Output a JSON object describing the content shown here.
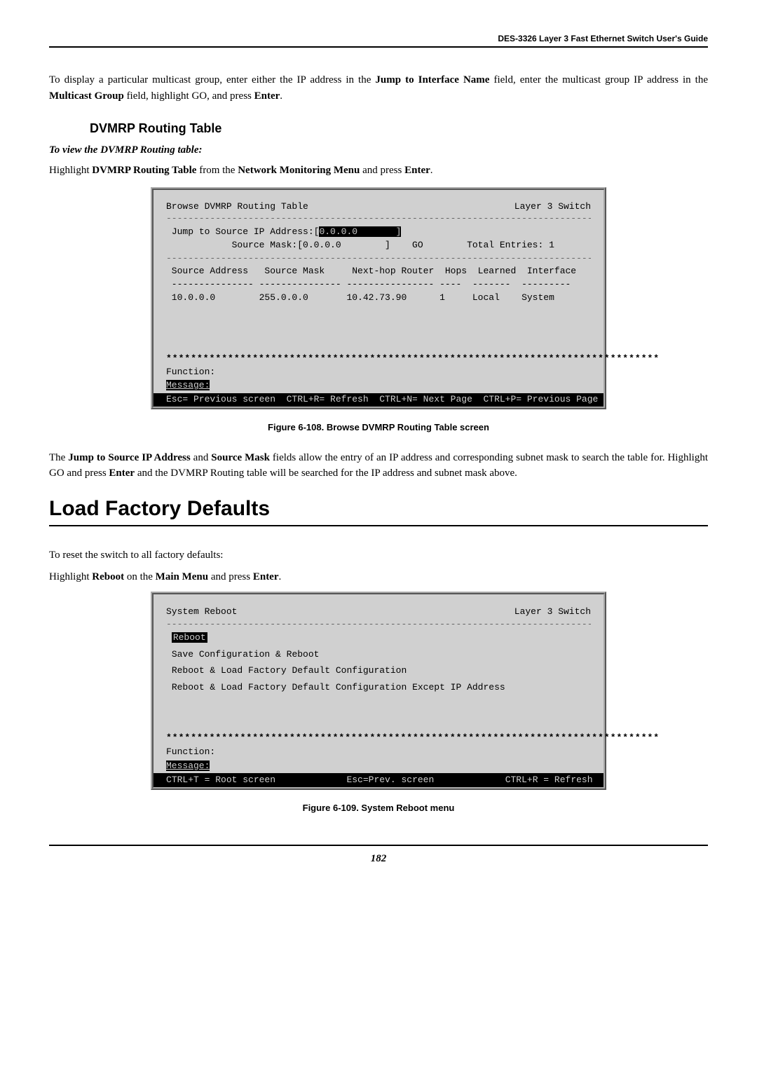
{
  "header": "DES-3326 Layer 3 Fast Ethernet Switch User's Guide",
  "para1": {
    "text1": "To display a particular multicast group, enter either the IP address in the ",
    "bold1": "Jump to Interface Name",
    "text2": " field, enter the multicast group IP address in the ",
    "bold2": "Multicast Group",
    "text3": " field, highlight GO, and press ",
    "bold3": "Enter",
    "text4": "."
  },
  "section1": "DVMRP Routing Table",
  "subhead1": "To view the DVMRP Routing table:",
  "instruction1": {
    "text1": "Highlight ",
    "bold1": "DVMRP Routing Table",
    "text2": " from the ",
    "bold2": "Network Monitoring Menu",
    "text3": " and press ",
    "bold3": "Enter",
    "text4": "."
  },
  "terminal1": {
    "title_left": "Browse DVMRP Routing Table",
    "title_right": "Layer 3 Switch",
    "jump_line": "Jump to Source IP Address:[",
    "ip_val": "0.0.0.0",
    "bracket1": "       ]",
    "mask_line": "            Source Mask:[0.0.0.0        ]    GO        Total Entries: 1",
    "headers": " Source Address   Source Mask     Next-hop Router  Hops  Learned  Interface",
    "underlines": " --------------- --------------- ---------------- ----  -------  ---------",
    "data_row": " 10.0.0.0        255.0.0.0       10.42.73.90      1     Local    System",
    "function": "Function:",
    "message": "Message:",
    "bottom": "Esc= Previous screen  CTRL+R= Refresh  CTRL+N= Next Page  CTRL+P= Previous Page"
  },
  "caption1": "Figure 6-108.  Browse DVMRP Routing Table screen",
  "para2": {
    "text1": "The ",
    "bold1": "Jump to Source IP Address",
    "text2": " and ",
    "bold2": "Source Mask",
    "text3": " fields allow the entry of an IP address and corresponding subnet mask to search the table for. Highlight GO and press ",
    "bold3": "Enter",
    "text4": " and the DVMRP Routing table will be searched for the IP address and subnet mask above."
  },
  "main_heading": "Load Factory Defaults",
  "para3": "To reset the switch to all factory defaults:",
  "instruction2": {
    "text1": "Highlight ",
    "bold1": "Reboot",
    "text2": " on the ",
    "bold2": "Main Menu",
    "text3": " and press ",
    "bold3": "Enter",
    "text4": "."
  },
  "terminal2": {
    "title_left": "System Reboot",
    "title_right": "Layer 3 Switch",
    "opt1": "Reboot",
    "opt2": "Save Configuration & Reboot",
    "opt3": "Reboot & Load Factory Default Configuration",
    "opt4": "Reboot & Load Factory Default Configuration Except IP Address",
    "function": "Function:",
    "message": "Message:",
    "bottom_left": "CTRL+T = Root screen",
    "bottom_mid": "Esc=Prev. screen",
    "bottom_right": "CTRL+R = Refresh"
  },
  "caption2": "Figure 6-109.  System Reboot menu",
  "page_number": "182"
}
